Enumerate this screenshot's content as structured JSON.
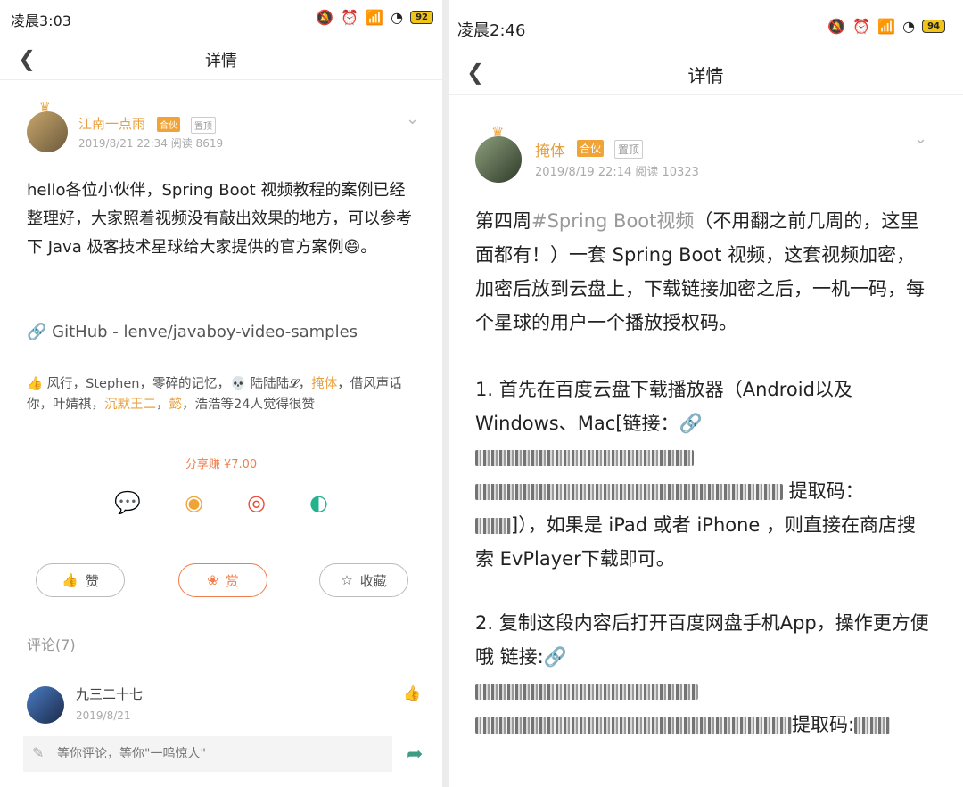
{
  "left": {
    "status": {
      "time": "凌晨3:03",
      "battery": "92"
    },
    "nav": {
      "title": "详情"
    },
    "post": {
      "author": "江南一点雨",
      "tag_partner": "合伙",
      "tag_top": "置顶",
      "meta": "2019/8/21 22:34  阅读 8619",
      "body": "hello各位小伙伴，Spring Boot 视频教程的案例已经整理好，大家照着视频没有敲出效果的地方，可以参考下 Java 极客技术星球给大家提供的官方案例😄。",
      "link": "GitHub - lenve/javaboy-video-samples",
      "likes_a": "风行，Stephen，零碎的记忆，💀 陆陆陆𝓛，",
      "likes_hl1": "掩体",
      "likes_b": "，借风声话你，叶婧祺，",
      "likes_hl2": "沉默王二",
      "likes_c": "，",
      "likes_hl3": "懿",
      "likes_d": "，浩浩等24人觉得很赞",
      "reward_text": "分享赚 ¥7.00"
    },
    "actions": {
      "like": "赞",
      "reward": "赏",
      "favorite": "收藏"
    },
    "comments": {
      "title": "评论(7)",
      "items": [
        {
          "name": "九三二十七",
          "date": "2019/8/21"
        }
      ],
      "input_placeholder": "等你评论，等你\"一鸣惊人\""
    }
  },
  "right": {
    "status": {
      "time": "凌晨2:46",
      "battery": "94"
    },
    "nav": {
      "title": "详情"
    },
    "post": {
      "author": "掩体",
      "tag_partner": "合伙",
      "tag_top": "置顶",
      "meta": "2019/8/19 22:14  阅读 10323",
      "p1_a": "第四周",
      "p1_tag": "#Spring Boot视频",
      "p1_b": "（不用翻之前几周的，这里面都有！）一套 Spring Boot 视频，这套视频加密，加密后放到云盘上，下载链接加密之后，一机一码，每个星球的用户一个播放授权码。",
      "p2_a": "1. 首先在百度云盘下载播放器（Android以及Windows、Mac[链接：",
      "p2_code_label": " 提取码：",
      "p2_b": "]），如果是 iPad 或者 iPhone ，则直接在商店搜索 EvPlayer下载即可。",
      "p3_a": "2. 复制这段内容后打开百度网盘手机App，操作更方便哦 链接:",
      "p3_code_label": "提取码:"
    }
  }
}
